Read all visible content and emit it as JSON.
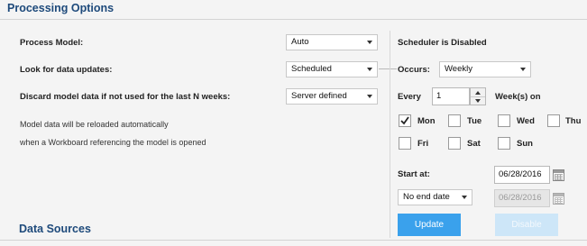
{
  "header": {
    "title": "Processing Options"
  },
  "left": {
    "process_model": {
      "label": "Process Model:",
      "value": "Auto"
    },
    "look_updates": {
      "label": "Look for data updates:",
      "value": "Scheduled"
    },
    "discard": {
      "label": "Discard model data if not used for the last N weeks:",
      "value": "Server defined"
    },
    "note_line1": "Model data will be reloaded automatically",
    "note_line2": "when a Workboard referencing the model is opened"
  },
  "scheduler": {
    "status": "Scheduler is Disabled",
    "occurs_label": "Occurs:",
    "occurs_value": "Weekly",
    "every_label": "Every",
    "every_value": "1",
    "weeks_label": "Week(s) on",
    "days": [
      {
        "label": "Mon",
        "checked": true
      },
      {
        "label": "Tue",
        "checked": false
      },
      {
        "label": "Wed",
        "checked": false
      },
      {
        "label": "Thu",
        "checked": false
      },
      {
        "label": "Fri",
        "checked": false
      },
      {
        "label": "Sat",
        "checked": false
      },
      {
        "label": "Sun",
        "checked": false
      }
    ],
    "start_label": "Start at:",
    "start_date": "06/28/2016",
    "end_option": "No end date",
    "end_date": "06/28/2016",
    "update_label": "Update",
    "disable_label": "Disable"
  },
  "data_sources": {
    "title": "Data Sources"
  }
}
